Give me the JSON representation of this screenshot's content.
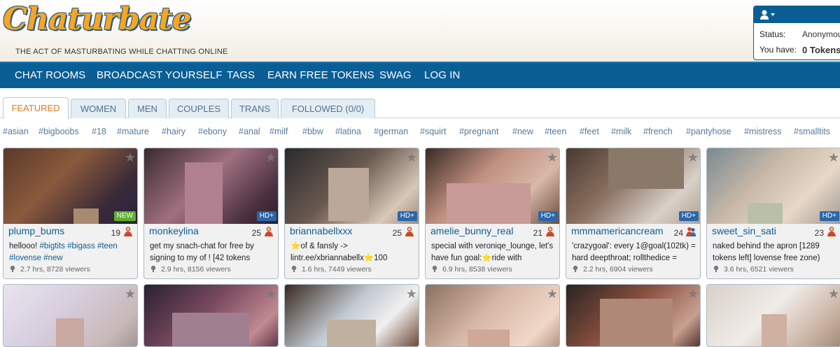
{
  "header": {
    "logo_text": "Chaturbate",
    "tagline": "THE ACT OF MASTURBATING WHILE CHATTING ONLINE"
  },
  "user_box": {
    "status_label": "Status:",
    "status_value": "Anonymous",
    "tokens_label": "You have:",
    "tokens_value": "0 Tokens"
  },
  "nav": [
    "CHAT ROOMS",
    "BROADCAST YOURSELF",
    "TAGS",
    "EARN FREE TOKENS",
    "SWAG",
    "LOG IN"
  ],
  "tabs": [
    "FEATURED",
    "WOMEN",
    "MEN",
    "COUPLES",
    "TRANS",
    "FOLLOWED (0/0)"
  ],
  "active_tab": "FEATURED",
  "hashtags": [
    "#asian",
    "#bigboobs",
    "#18",
    "#mature",
    "#hairy",
    "#ebony",
    "#anal",
    "#milf",
    "#bbw",
    "#latina",
    "#german",
    "#squirt",
    "#pregnant",
    "#new",
    "#teen",
    "#feet",
    "#milk",
    "#french",
    "#pantyhose",
    "#mistress",
    "#smalltits"
  ],
  "colors": {
    "nav_bg": "#0b5e94",
    "link": "#0b5e94",
    "active_tab": "#e07a1f",
    "hd_badge": "#2a66a8",
    "new_badge": "#5fae2e"
  },
  "rooms": [
    {
      "name": "plump_bums",
      "age": "19",
      "gender": "female",
      "badge": "NEW",
      "subject": [
        "hellooo! ",
        {
          "t": "#bigtits"
        },
        " ",
        {
          "t": "#bigass"
        },
        " ",
        {
          "t": "#teen"
        },
        " ",
        {
          "t": "#lovense"
        },
        " ",
        {
          "t": "#new"
        }
      ],
      "meta": "2.7 hrs, 8728 viewers"
    },
    {
      "name": "monkeylina",
      "age": "25",
      "gender": "female",
      "badge": "HD+",
      "subject": [
        "get my snach-chat for free by signing to my of ! [42 tokens"
      ],
      "meta": "2.9 hrs, 8156 viewers"
    },
    {
      "name": "briannabellxxx",
      "age": "25",
      "gender": "female",
      "badge": "HD+",
      "subject": [
        "⭐of & fansly -> lintr.ee/xbriannabellx⭐100"
      ],
      "meta": "1.6 hrs, 7449 viewers"
    },
    {
      "name": "amelie_bunny_real",
      "age": "21",
      "gender": "female",
      "badge": "HD+",
      "subject": [
        "special with veroniqe_lounge, let's have fun goal:⭐ride with"
      ],
      "meta": "6.9 hrs, 8538 viewers"
    },
    {
      "name": "mmmamericancream",
      "age": "24",
      "gender": "couple",
      "badge": "HD+",
      "subject": [
        "'crazygoal': every 1@goal(102tk) = hard deepthroat; rollthedice ="
      ],
      "meta": "2.2 hrs, 6904 viewers"
    },
    {
      "name": "sweet_sin_sati",
      "age": "23",
      "gender": "female",
      "badge": "HD+",
      "subject": [
        "naked behind the apron [1289 tokens left] lovense free zone)"
      ],
      "meta": "3.6 hrs, 6521 viewers"
    }
  ]
}
